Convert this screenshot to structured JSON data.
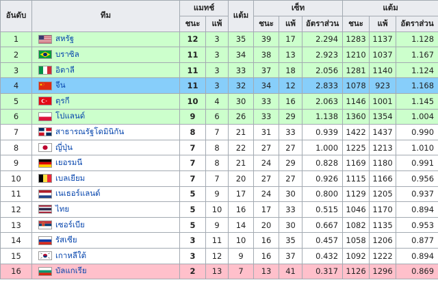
{
  "headers": {
    "rank": "อันดับ",
    "team": "ทีม",
    "matches": "แมทช์",
    "points": "แต้ม",
    "sets": "เซ็ท",
    "score": "แต้ม",
    "won": "ชนะ",
    "lost": "แพ้",
    "ratio": "อัตราส่วน"
  },
  "rows": [
    {
      "rank": "1",
      "team": "สหรัฐ",
      "flag": "usa-flag",
      "mw": "12",
      "ml": "3",
      "pts": "35",
      "sw": "39",
      "sl": "17",
      "sr": "2.294",
      "pw": "1283",
      "pl": "1137",
      "pr": "1.128",
      "hl": "green"
    },
    {
      "rank": "2",
      "team": "บราซิล",
      "flag": "brazil-flag",
      "mw": "11",
      "ml": "3",
      "pts": "34",
      "sw": "38",
      "sl": "13",
      "sr": "2.923",
      "pw": "1210",
      "pl": "1037",
      "pr": "1.167",
      "hl": "green"
    },
    {
      "rank": "3",
      "team": "อิตาลี",
      "flag": "italy-flag",
      "mw": "11",
      "ml": "3",
      "pts": "33",
      "sw": "37",
      "sl": "18",
      "sr": "2.056",
      "pw": "1281",
      "pl": "1140",
      "pr": "1.124",
      "hl": "green"
    },
    {
      "rank": "4",
      "team": "จีน",
      "flag": "china-flag",
      "mw": "11",
      "ml": "3",
      "pts": "32",
      "sw": "34",
      "sl": "12",
      "sr": "2.833",
      "pw": "1078",
      "pl": "923",
      "pr": "1.168",
      "hl": "blue"
    },
    {
      "rank": "5",
      "team": "ตุรกี",
      "flag": "turkey-flag",
      "mw": "10",
      "ml": "4",
      "pts": "30",
      "sw": "33",
      "sl": "16",
      "sr": "2.063",
      "pw": "1146",
      "pl": "1001",
      "pr": "1.145",
      "hl": "green"
    },
    {
      "rank": "6",
      "team": "โปแลนด์",
      "flag": "poland-flag",
      "mw": "9",
      "ml": "6",
      "pts": "26",
      "sw": "33",
      "sl": "29",
      "sr": "1.138",
      "pw": "1360",
      "pl": "1354",
      "pr": "1.004",
      "hl": "green"
    },
    {
      "rank": "7",
      "team": "สาธารณรัฐโดมินิกัน",
      "flag": "dominican-republic-flag",
      "mw": "8",
      "ml": "7",
      "pts": "21",
      "sw": "31",
      "sl": "33",
      "sr": "0.939",
      "pw": "1422",
      "pl": "1437",
      "pr": "0.990",
      "hl": ""
    },
    {
      "rank": "8",
      "team": "ญี่ปุ่น",
      "flag": "japan-flag",
      "mw": "7",
      "ml": "8",
      "pts": "22",
      "sw": "27",
      "sl": "27",
      "sr": "1.000",
      "pw": "1225",
      "pl": "1213",
      "pr": "1.010",
      "hl": ""
    },
    {
      "rank": "9",
      "team": "เยอรมนี",
      "flag": "germany-flag",
      "mw": "7",
      "ml": "8",
      "pts": "21",
      "sw": "24",
      "sl": "29",
      "sr": "0.828",
      "pw": "1169",
      "pl": "1180",
      "pr": "0.991",
      "hl": ""
    },
    {
      "rank": "10",
      "team": "เบลเยียม",
      "flag": "belgium-flag",
      "mw": "7",
      "ml": "7",
      "pts": "20",
      "sw": "27",
      "sl": "27",
      "sr": "0.926",
      "pw": "1115",
      "pl": "1166",
      "pr": "0.956",
      "hl": ""
    },
    {
      "rank": "11",
      "team": "เนเธอร์แลนด์",
      "flag": "netherlands-flag",
      "mw": "5",
      "ml": "9",
      "pts": "17",
      "sw": "24",
      "sl": "30",
      "sr": "0.800",
      "pw": "1129",
      "pl": "1205",
      "pr": "0.937",
      "hl": ""
    },
    {
      "rank": "12",
      "team": "ไทย",
      "flag": "thailand-flag",
      "mw": "5",
      "ml": "10",
      "pts": "16",
      "sw": "17",
      "sl": "33",
      "sr": "0.515",
      "pw": "1046",
      "pl": "1170",
      "pr": "0.894",
      "hl": ""
    },
    {
      "rank": "13",
      "team": "เซอร์เบีย",
      "flag": "serbia-flag",
      "mw": "5",
      "ml": "9",
      "pts": "14",
      "sw": "20",
      "sl": "30",
      "sr": "0.667",
      "pw": "1082",
      "pl": "1135",
      "pr": "0.953",
      "hl": ""
    },
    {
      "rank": "14",
      "team": "รัสเซีย",
      "flag": "russia-flag",
      "mw": "3",
      "ml": "11",
      "pts": "10",
      "sw": "16",
      "sl": "35",
      "sr": "0.457",
      "pw": "1058",
      "pl": "1206",
      "pr": "0.877",
      "hl": ""
    },
    {
      "rank": "15",
      "team": "เกาหลีใต้",
      "flag": "south-korea-flag",
      "mw": "3",
      "ml": "12",
      "pts": "9",
      "sw": "16",
      "sl": "37",
      "sr": "0.432",
      "pw": "1092",
      "pl": "1222",
      "pr": "0.894",
      "hl": ""
    },
    {
      "rank": "16",
      "team": "บัลแกเรีย",
      "flag": "bulgaria-flag",
      "mw": "2",
      "ml": "13",
      "pts": "7",
      "sw": "13",
      "sl": "41",
      "sr": "0.317",
      "pw": "1126",
      "pl": "1296",
      "pr": "0.869",
      "hl": "red"
    }
  ]
}
